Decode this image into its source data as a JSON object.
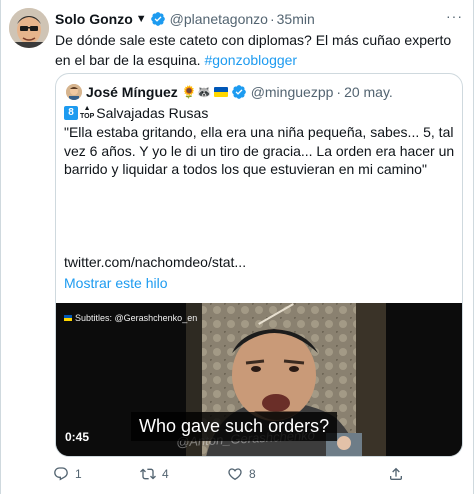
{
  "tweet": {
    "author_name": "Solo Gonzo",
    "author_name_suffix": "▼",
    "handle": "@planetagonzo",
    "separator": "·",
    "time": "35min",
    "text_main": "De dónde sale este cateto con diplomas? El más cuñao experto en el bar de la esquina. ",
    "hashtag": "#gonzoblogger",
    "more_label": "···"
  },
  "quote": {
    "author_name": "José Mínguez",
    "emojis": "🌻🦝",
    "handle": "@minguezpp",
    "separator": "·",
    "time": "20 may.",
    "badge_number": "8",
    "badge_top": "TOP",
    "top_label": "Salvajadas Rusas",
    "body": "\"Ella estaba gritando, ella era una niña pequeña, sabes... 5, tal vez 6 años. Y yo le di un tiro de gracia... La orden era hacer un barrido y liquidar a todos los que estuvieran en mi camino\"",
    "link": "twitter.com/nachomdeo/stat...",
    "show_thread": "Mostrar este hilo"
  },
  "video": {
    "subtitle_credit": "Subtitles: @Gerashchenko_en",
    "watermark": "@Anton_Gerashchenko",
    "caption": "Who gave such orders?",
    "duration": "0:45"
  },
  "actions": {
    "reply_count": "1",
    "retweet_count": "4",
    "like_count": "8"
  },
  "colors": {
    "accent": "#1d9bf0",
    "text": "#0f1419",
    "secondary": "#536471",
    "border": "#cfd9de"
  }
}
